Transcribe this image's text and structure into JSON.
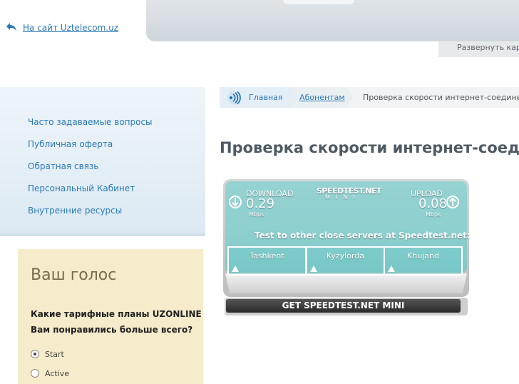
{
  "header": {
    "back_link": "На сайт Uztelecom.uz",
    "expand_map": "Развернуть карт"
  },
  "sidebar": {
    "items": [
      {
        "label": "Часто задаваемые вопросы"
      },
      {
        "label": "Публичная оферта"
      },
      {
        "label": "Обратная связь"
      },
      {
        "label": "Персональный Кабинет"
      },
      {
        "label": "Внутренние ресурсы"
      }
    ]
  },
  "poll": {
    "title": "Ваш голос",
    "question_line1": "Какие тарифные планы UZONLINE",
    "question_line2": "Вам понравились больше всего?",
    "options": [
      {
        "label": "Start",
        "selected": true
      },
      {
        "label": "Active",
        "selected": false
      }
    ]
  },
  "breadcrumb": {
    "home": "Главная",
    "subscribers": "Абонентам",
    "current": "Проверка скорости интернет-соединения"
  },
  "page": {
    "title": "Проверка скорости интернет-соедин"
  },
  "speedtest": {
    "brand": "SPEEDTEST.NET",
    "brand_sub": "MINI",
    "download_label": "DOWNLOAD",
    "download_value": "0.29",
    "download_unit": "Mbps",
    "upload_label": "UPLOAD",
    "upload_value": "0.08",
    "upload_unit": "Mbps",
    "test_other": "Test to other close servers at Speedtest.net:",
    "servers": [
      {
        "label": "Tashkent"
      },
      {
        "label": "Kyzylorda"
      },
      {
        "label": "Khujand"
      }
    ],
    "get_button": "GET SPEEDTEST.NET MINI"
  },
  "icons": {
    "back": "back-arrow-icon",
    "breadcrumb_home": "wifi-signal-icon",
    "download": "download-arrow-icon",
    "upload": "upload-arrow-icon"
  },
  "colors": {
    "link": "#2a7ab8",
    "poll_bg": "#f6ebca",
    "speedtest_panel": "#8fd0cf"
  }
}
